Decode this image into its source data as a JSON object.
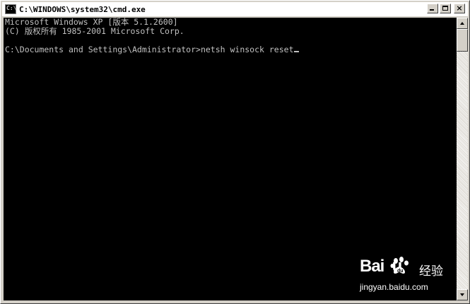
{
  "window": {
    "title": "C:\\WINDOWS\\system32\\cmd.exe",
    "icon_text": "C:\\"
  },
  "caption_buttons": {
    "minimize_icon": "minimize-icon",
    "maximize_icon": "maximize-icon",
    "close_glyph": "×"
  },
  "console": {
    "lines": [
      "Microsoft Windows XP [版本 5.1.2600]",
      "(C) 版权所有 1985-2001 Microsoft Corp.",
      "",
      "C:\\Documents and Settings\\Administrator>netsh winsock reset"
    ],
    "colors": {
      "background": "#000000",
      "text": "#c0c0c0"
    }
  },
  "watermark": {
    "brand": "Bai  u",
    "brand_cn": "经验",
    "url": "jingyan.baidu.com"
  }
}
